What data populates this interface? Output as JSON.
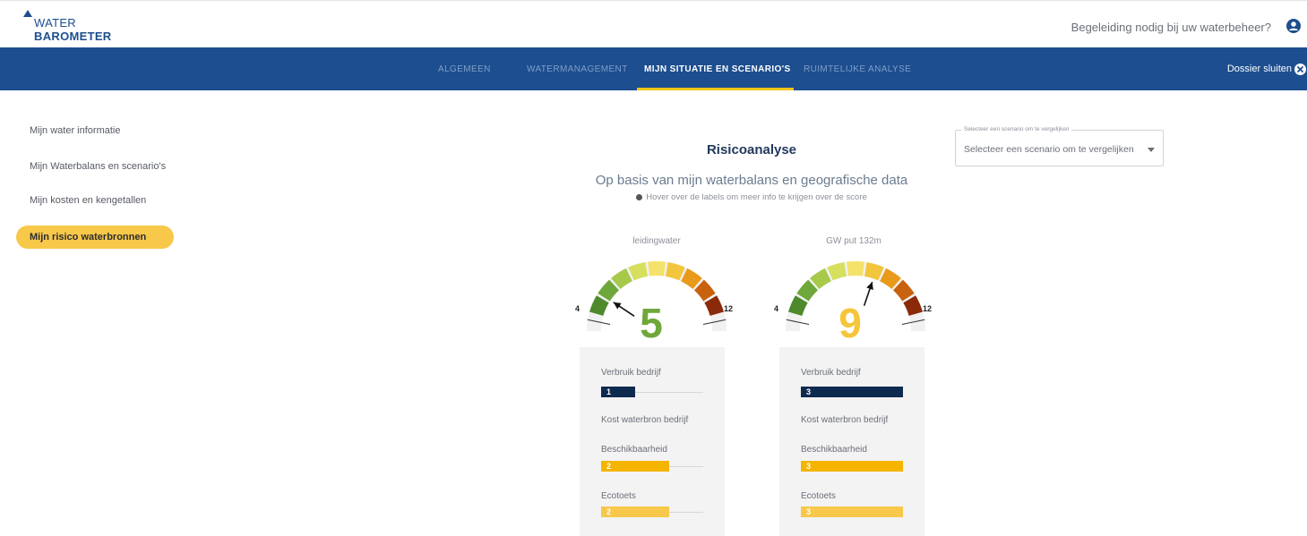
{
  "header": {
    "logo_line1": "WATER",
    "logo_line2": "BAROMETER",
    "help_text": "Begeleiding nodig bij uw waterbeheer?",
    "user_icon": "user-circle-icon"
  },
  "nav": {
    "tabs": [
      {
        "label": "ALGEMEEN",
        "active": false
      },
      {
        "label": "WATERMANAGEMENT",
        "active": false
      },
      {
        "label": "MIJN SITUATIE EN SCENARIO'S",
        "active": true
      },
      {
        "label": "RUIMTELIJKE ANALYSE",
        "active": false
      }
    ],
    "close_label": "Dossier sluiten",
    "close_icon": "close-circle-icon"
  },
  "sidebar": {
    "items": [
      {
        "label": "Mijn water informatie",
        "active": false
      },
      {
        "label": "Mijn Waterbalans en scenario's",
        "active": false
      },
      {
        "label": "Mijn kosten en kengetallen",
        "active": false
      },
      {
        "label": "Mijn risico waterbronnen",
        "active": true
      }
    ]
  },
  "main": {
    "title": "Risicoanalyse",
    "subtitle": "Op basis van mijn waterbalans en geografische data",
    "hint": "Hover over de labels om meer info te krijgen over de score",
    "hint_icon": "info-icon"
  },
  "scenario": {
    "legend": "Selecteer een scenario om te vergelijken",
    "selected": "Selecteer een scenario om te vergelijken"
  },
  "colors": {
    "navy": "#1d4e8f",
    "accent_yellow": "#f5c518",
    "bar_navy": "#0f2a4f",
    "bar_orange": "#f5b400",
    "bar_yellow": "#f7c84a",
    "score_green": "#6fa83a",
    "score_yellow": "#f5c53a"
  },
  "gauges": [
    {
      "name": "leidingwater",
      "min": 4,
      "max": 12,
      "min_label": "4",
      "max_label": "12",
      "score": 5,
      "score_label": "5",
      "score_color": "#6fa83a",
      "metrics": [
        {
          "label": "Verbruik bedrijf",
          "value": 1,
          "value_label": "1",
          "max": 3,
          "color": "#0f2a4f"
        },
        {
          "label": "Kost waterbron bedrijf",
          "value": null,
          "value_label": "",
          "max": 3,
          "color": ""
        },
        {
          "label": "Beschikbaarheid",
          "value": 2,
          "value_label": "2",
          "max": 3,
          "color": "#f5b400"
        },
        {
          "label": "Ecotoets",
          "value": 2,
          "value_label": "2",
          "max": 3,
          "color": "#f7c84a"
        }
      ]
    },
    {
      "name": "GW put 132m",
      "min": 4,
      "max": 12,
      "min_label": "4",
      "max_label": "12",
      "score": 9,
      "score_label": "9",
      "score_color": "#f5c53a",
      "metrics": [
        {
          "label": "Verbruik bedrijf",
          "value": 3,
          "value_label": "3",
          "max": 3,
          "color": "#0f2a4f"
        },
        {
          "label": "Kost waterbron bedrijf",
          "value": null,
          "value_label": "",
          "max": 3,
          "color": ""
        },
        {
          "label": "Beschikbaarheid",
          "value": 3,
          "value_label": "3",
          "max": 3,
          "color": "#f5b400"
        },
        {
          "label": "Ecotoets",
          "value": 3,
          "value_label": "3",
          "max": 3,
          "color": "#f7c84a"
        }
      ]
    }
  ]
}
